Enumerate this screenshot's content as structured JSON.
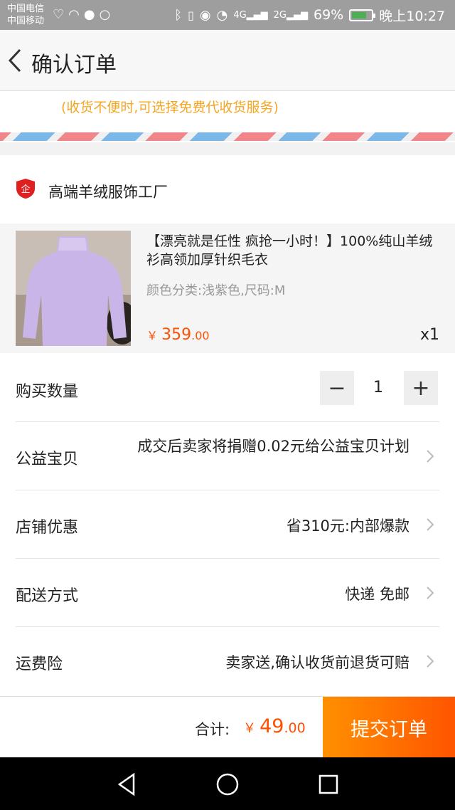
{
  "status_bar": {
    "carrier_1": "中国电信",
    "carrier_2": "中国移动",
    "battery": "69%",
    "time": "晚上10:27"
  },
  "header": {
    "title": "确认订单"
  },
  "address": {
    "hint": "(收货不便时,可选择免费代收货服务)"
  },
  "shop": {
    "name": "高端羊绒服饰工厂",
    "icon_text": "企"
  },
  "item": {
    "title": "【漂亮就是任性 疯抢一小时！】100%纯山羊绒衫高领加厚针织毛衣",
    "sku": "颜色分类:浅紫色,尺码:M",
    "price_currency": "￥",
    "price_int": "359",
    "price_dec": ".00",
    "quantity": "x1"
  },
  "options": {
    "quantity_label": "购买数量",
    "quantity_value": "1",
    "charity_label": "公益宝贝",
    "charity_value": "成交后卖家将捐赠0.02元给公益宝贝计划",
    "discount_label": "店铺优惠",
    "discount_value": "省310元:内部爆款",
    "shipping_label": "配送方式",
    "shipping_value": "快递 免邮",
    "insurance_label": "运费险",
    "insurance_value": "卖家送,确认收货前退货可赔"
  },
  "bottom": {
    "total_label": "合计:",
    "total_currency": "￥",
    "total_int": "49",
    "total_dec": ".00",
    "submit_label": "提交订单"
  },
  "colors": {
    "accent": "#ff5000",
    "hint": "#f5a623",
    "submit_from": "#ff9000",
    "submit_to": "#ff5500"
  }
}
